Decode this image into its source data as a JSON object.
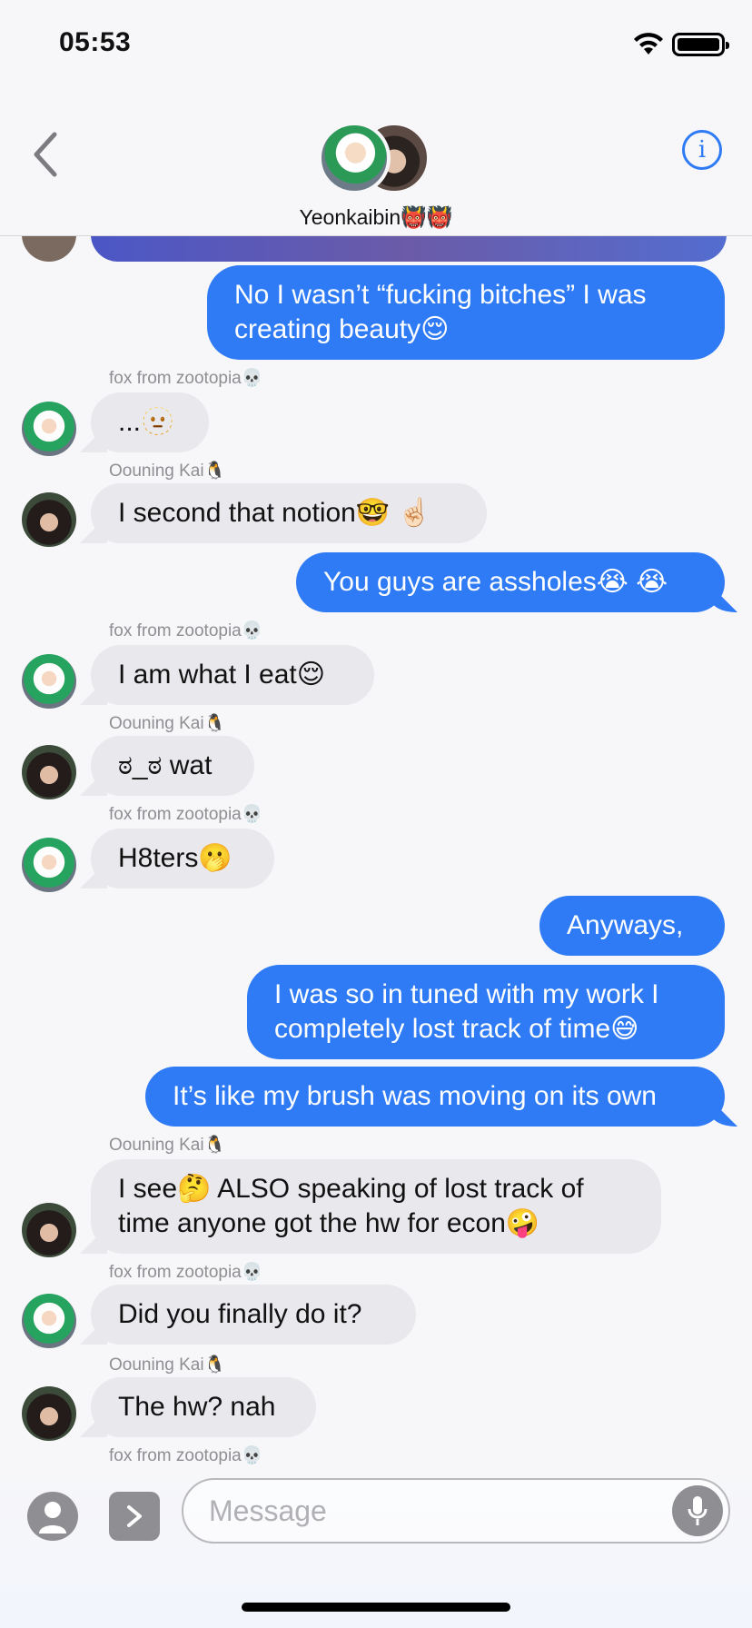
{
  "status": {
    "time": "05:53"
  },
  "header": {
    "group_name": "Yeonkaibin👹👹"
  },
  "composer": {
    "placeholder": "Message"
  },
  "messages": [
    {
      "text": "No I wasn’t “fucking bitches” I was\ncreating beauty😌"
    },
    {
      "sender": "fox from zootopia💀",
      "text": "...🫥"
    },
    {
      "sender": "Oouning Kai🐧",
      "text": "I second that notion🤓 ☝🏻"
    },
    {
      "text": "You guys are assholes😭 😭"
    },
    {
      "sender": "fox from zootopia💀",
      "text": "I am what I eat😌"
    },
    {
      "sender": "Oouning Kai🐧",
      "text": "ಠ_ಠ wat"
    },
    {
      "sender": "fox from zootopia💀",
      "text": "H8ters🫢"
    },
    {
      "text": "Anyways,"
    },
    {
      "text": "I was so in tuned with my work I\ncompletely lost track of time😅"
    },
    {
      "text": "It’s like my brush was moving on its own"
    },
    {
      "sender": "Oouning Kai🐧",
      "text": "I see🤔 ALSO speaking of lost track of\ntime anyone got the hw for econ🤪"
    },
    {
      "sender": "fox from zootopia💀",
      "text": "Did you finally do it?"
    },
    {
      "sender": "Oouning Kai🐧",
      "text": "The hw? nah"
    },
    {
      "sender": "fox from zootopia💀"
    }
  ]
}
